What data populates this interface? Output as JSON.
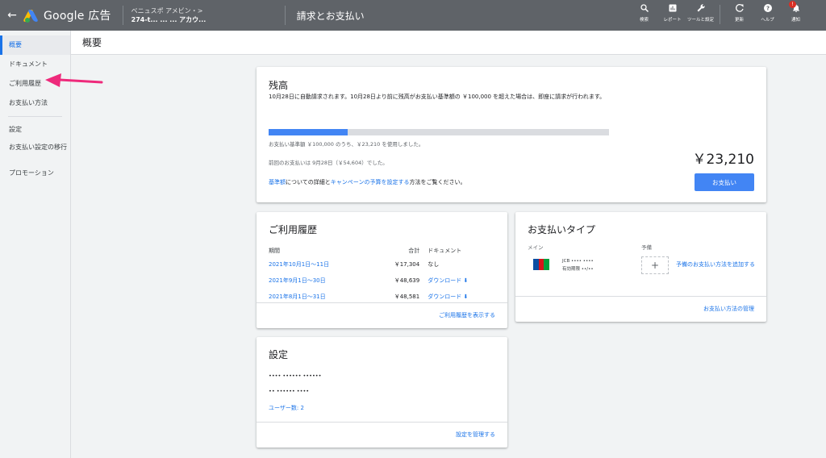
{
  "topbar": {
    "brand": "Google 広告",
    "account_line1": "ベニュスポ アメビン・>",
    "account_line2": "274-t...  ... ... アカウ...",
    "page_title": "請求とお支払い",
    "tools": [
      {
        "icon": "search-icon",
        "label": "検索"
      },
      {
        "icon": "report-icon",
        "label": "レポート"
      },
      {
        "icon": "wrench-icon",
        "label": "ツールと設定"
      },
      {
        "icon": "refresh-icon",
        "label": "更新"
      },
      {
        "icon": "help-icon",
        "label": "ヘルプ"
      },
      {
        "icon": "bell-icon",
        "label": "通知",
        "badge": "!"
      }
    ]
  },
  "sidebar": {
    "items": [
      {
        "label": "概要",
        "active": true
      },
      {
        "label": "ドキュメント"
      },
      {
        "label": "ご利用履歴"
      },
      {
        "label": "お支払い方法"
      },
      {
        "label": "設定"
      },
      {
        "label": "お支払い設定の移行"
      },
      {
        "label": "プロモーション"
      }
    ]
  },
  "header": {
    "title": "概要"
  },
  "balance": {
    "title": "残高",
    "amount": "￥23,210",
    "description": "10月28日に自動請求されます。10月28日より前に残高がお支払い基準額の ￥100,000 を超えた場合は、即座に請求が行われます。",
    "progress": 0.2321,
    "used_text": "お支払い基準額 ￥100,000 のうち、￥23,210 を使用しました。",
    "previous_text": "前回のお支払いは 9月28日（￥54,604）でした。",
    "info_link1": "基準額",
    "info_text1": "についての詳細と",
    "info_link2": "キャンペーンの予算を設定する",
    "info_text2": "方法をご覧ください。",
    "pay_button": "お支払い"
  },
  "history": {
    "title": "ご利用履歴",
    "headers": [
      "期間",
      "合計",
      "ドキュメント"
    ],
    "rows": [
      {
        "period": "2021年10月1日～11日",
        "total": "￥17,304",
        "doc": "なし",
        "doc_link": false
      },
      {
        "period": "2021年9月1日～30日",
        "total": "￥48,639",
        "doc": "ダウンロード",
        "doc_link": true
      },
      {
        "period": "2021年8月1日～31日",
        "total": "￥48,581",
        "doc": "ダウンロード",
        "doc_link": true
      }
    ],
    "more_link": "ご利用履歴を表示する"
  },
  "payment_type": {
    "title": "お支払いタイプ",
    "main_label": "メイン",
    "backup_label": "予備",
    "card_line1": "JCB •••• ••••",
    "card_line2": "有効期限 ••/••",
    "add_icon": "plus-icon",
    "add_link": "予備のお支払い方法を追加する",
    "manage_link": "お支払い方法の管理"
  },
  "settings": {
    "title": "設定",
    "line1": "•••• •••••• ••••••",
    "line2": "•• •••••• ••••",
    "users_link": "ユーザー数: 2",
    "manage_link": "設定を管理する"
  },
  "colors": {
    "topbar": "#5f6368",
    "accent": "#1a73e8",
    "button": "#4285f4",
    "annotation": "#ee2a7b"
  }
}
